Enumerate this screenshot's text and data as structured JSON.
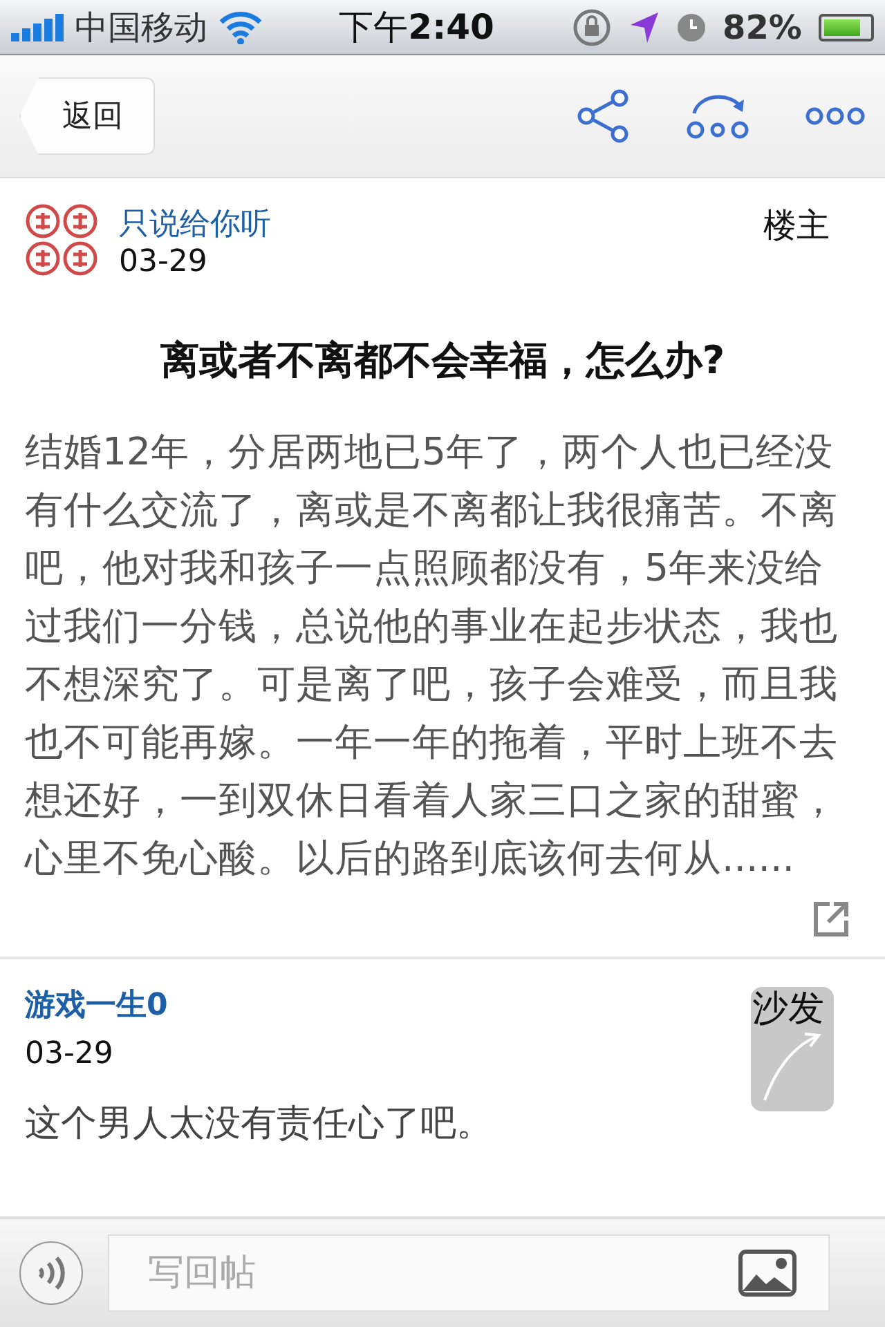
{
  "status_bar": {
    "carrier": "中国移动",
    "time_prefix": "下午",
    "time": "2:40",
    "battery": "82%"
  },
  "nav": {
    "back": "返回"
  },
  "post": {
    "author": "只说给你听",
    "date": "03-29",
    "floor": "楼主",
    "title": "离或者不离都不会幸福，怎么办?",
    "body": "结婚12年，分居两地已5年了，两个人也已经没有什么交流了，离或是不离都让我很痛苦。不离吧，他对我和孩子一点照顾都没有，5年来没给过我们一分钱，总说他的事业在起步状态，我也不想深究了。可是离了吧，孩子会难受，而且我也不可能再嫁。一年一年的拖着，平时上班不去想还好，一到双休日看着人家三口之家的甜蜜，心里不免心酸。以后的路到底该何去何从......"
  },
  "replies": [
    {
      "author": "游戏一生0",
      "date": "03-29",
      "floor": "沙发",
      "text": "这个男人太没有责任心了吧。"
    }
  ],
  "composer": {
    "placeholder": "写回帖"
  }
}
